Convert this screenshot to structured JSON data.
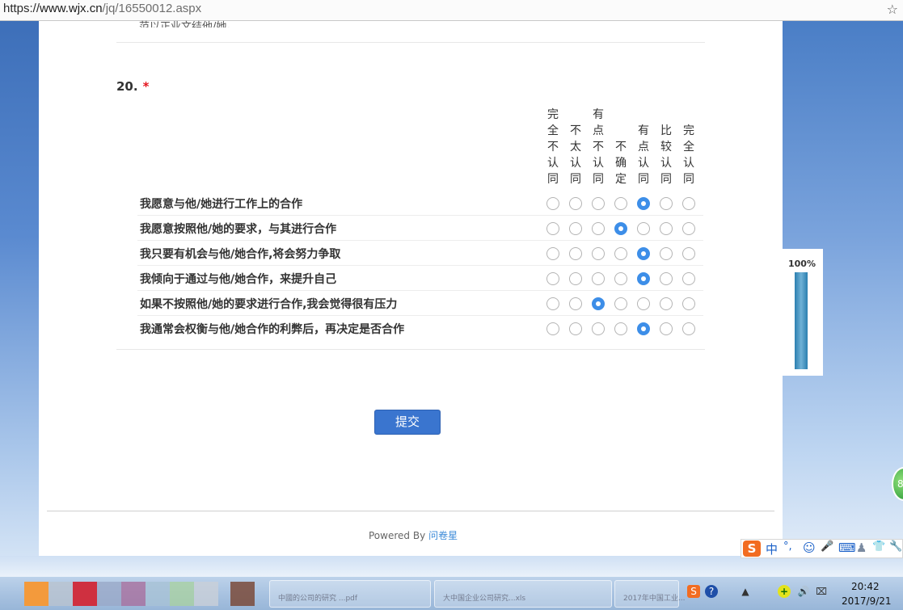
{
  "browser": {
    "url_scheme": "https://",
    "url_host": "www.wjx.cn",
    "url_path": "/jq/16550012.aspx",
    "star_glyph": "☆"
  },
  "page": {
    "prev_question_tail": "范以正业文结他/她。",
    "question": {
      "number": "20.",
      "required_mark": "*",
      "columns": [
        "完全不认同",
        "不太认同",
        "有点不认同",
        "不确定",
        "有点认同",
        "比较认同",
        "完全认同"
      ],
      "rows": [
        {
          "text": "我愿意与他/她进行工作上的合作",
          "selected": 4
        },
        {
          "text": "我愿意按照他/她的要求，与其进行合作",
          "selected": 3
        },
        {
          "text": "我只要有机会与他/她合作,将会努力争取",
          "selected": 4
        },
        {
          "text": "我倾向于通过与他/她合作，来提升自己",
          "selected": 4
        },
        {
          "text": "如果不按照他/她的要求进行合作,我会觉得很有压力",
          "selected": 2
        },
        {
          "text": "我通常会权衡与他/她合作的利弊后，再决定是否合作",
          "selected": 4
        }
      ]
    },
    "submit_label": "提交",
    "footer_powered": "Powered By",
    "footer_brand": "问卷星"
  },
  "progress": {
    "label": "100%",
    "value": 1.0,
    "fill_color": "#2b7fb0"
  },
  "colors": {
    "accent": "#3d8ee8",
    "submit": "#3a75cf",
    "required": "#e4141e"
  },
  "desktop": {
    "green_ball_text": "8"
  },
  "ime": {
    "logo": "S",
    "mode": "中",
    "punct": "°,",
    "emoji": "☺",
    "mic": "🎤",
    "keyboard": "⌨",
    "user": "♟",
    "shirt": "👕",
    "tool": "🔧"
  },
  "taskbar": {
    "labels": [
      "中國的公司的研究 ...pdf",
      "大中国企业公司研究...xls",
      "2017年中国工业..."
    ],
    "tray": [
      "S",
      "?",
      "▲",
      "+",
      "🔊",
      "⌧"
    ],
    "time": "20:42",
    "date": "2017/9/21"
  }
}
